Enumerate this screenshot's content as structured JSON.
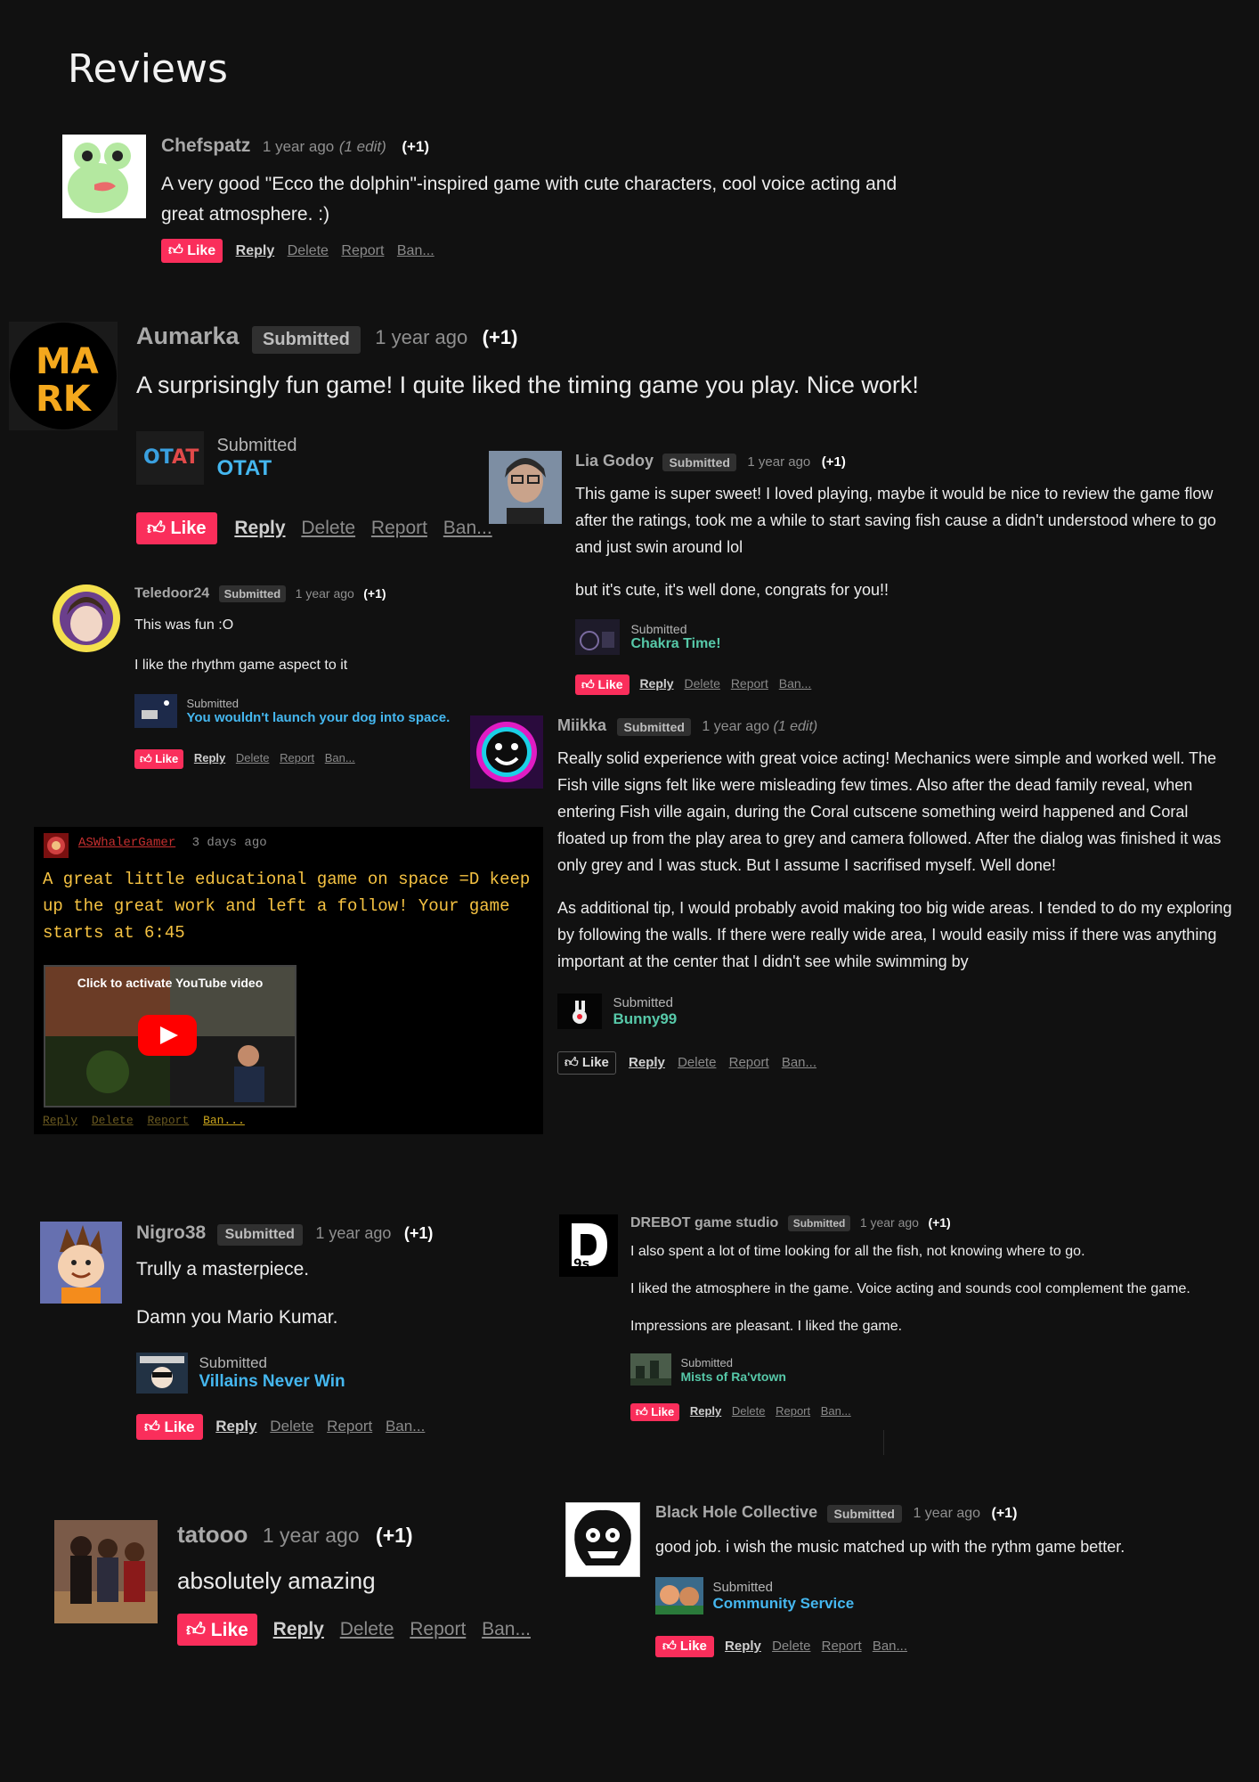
{
  "page": {
    "title": "Reviews"
  },
  "ui": {
    "like": "Like",
    "reply": "Reply",
    "delete": "Delete",
    "report": "Report",
    "ban": "Ban...",
    "submitted": "Submitted",
    "plus_one": "(+1)"
  },
  "reviews": [
    {
      "user": "Chefspatz",
      "time": "1 year ago",
      "edit": "(1 edit)",
      "score": "(+1)",
      "body": [
        "A very good \"Ecco the dolphin\"-inspired game with cute characters, cool voice acting and great atmosphere. :)"
      ]
    },
    {
      "user": "Aumarka",
      "badge": "Submitted",
      "time": "1 year ago",
      "score": "(+1)",
      "body": [
        "A surprisingly fun game! I quite liked the timing game you play. Nice work!"
      ],
      "game": "OTAT"
    },
    {
      "user": "Lia Godoy",
      "badge": "Submitted",
      "time": "1 year ago",
      "score": "(+1)",
      "body": [
        "This game is super sweet! I loved playing, maybe it would be nice to review the game flow after the ratings, took me a while to start saving fish cause a didn't understood where to go and just swin around lol",
        "but it's cute, it's well done, congrats for you!!"
      ],
      "game": "Chakra Time!"
    },
    {
      "user": "Teledoor24",
      "badge": "Submitted",
      "time": "1 year ago",
      "score": "(+1)",
      "body": [
        "This was fun :O",
        "I like the rhythm game aspect to it"
      ],
      "game": "You wouldn't launch your dog into space."
    },
    {
      "user": "Miikka",
      "badge": "Submitted",
      "time": "1 year ago",
      "edit": "(1 edit)",
      "body": [
        "Really solid experience with great voice acting! Mechanics were simple and worked well. The Fish ville signs felt like were misleading few times. Also after the dead family reveal, when entering Fish ville again, during the Coral cutscene something weird happened and Coral floated up from the play area to grey and camera followed. After the dialog was finished it was only grey and I was stuck. But I assume I sacrifised myself. Well done!",
        "As additional tip, I would probably avoid making too big wide areas. I tended to do my exploring by following the walls. If there were really wide area, I would easily miss if there was anything important at the center that I didn't see while swimming by"
      ],
      "game": "Bunny99"
    },
    {
      "user": "ASWhalerGamer",
      "time": "3 days ago",
      "body": [
        "A great little educational game on space =D keep up the great work and left a follow! Your game starts at 6:45"
      ],
      "video_label": "Click to activate YouTube video"
    },
    {
      "user": "Nigro38",
      "badge": "Submitted",
      "time": "1 year ago",
      "score": "(+1)",
      "body": [
        "Trully a masterpiece.",
        "Damn you Mario Kumar."
      ],
      "game": "Villains Never Win"
    },
    {
      "user": "DREBOT game studio",
      "badge": "Submitted",
      "time": "1 year ago",
      "score": "(+1)",
      "body": [
        "I also spent a lot of time looking for all the fish, not knowing where to go.",
        "I liked the atmosphere in the game. Voice acting and sounds cool complement the game.",
        "Impressions are pleasant. I liked the game."
      ],
      "game": "Mists of Ra'vtown"
    },
    {
      "user": "tatooo",
      "time": "1 year ago",
      "score": "(+1)",
      "body": [
        "absolutely amazing"
      ]
    },
    {
      "user": "Black Hole Collective",
      "badge": "Submitted",
      "time": "1 year ago",
      "score": "(+1)",
      "body": [
        "good job. i wish the music matched up with the rythm game better."
      ],
      "game": "Community Service"
    }
  ],
  "colors": {
    "background": "#111111",
    "like": "#fa2e5b",
    "game_link_blue": "#45b7ef",
    "game_link_green": "#57c9a9",
    "yt_comment_text": "#f5c242"
  }
}
